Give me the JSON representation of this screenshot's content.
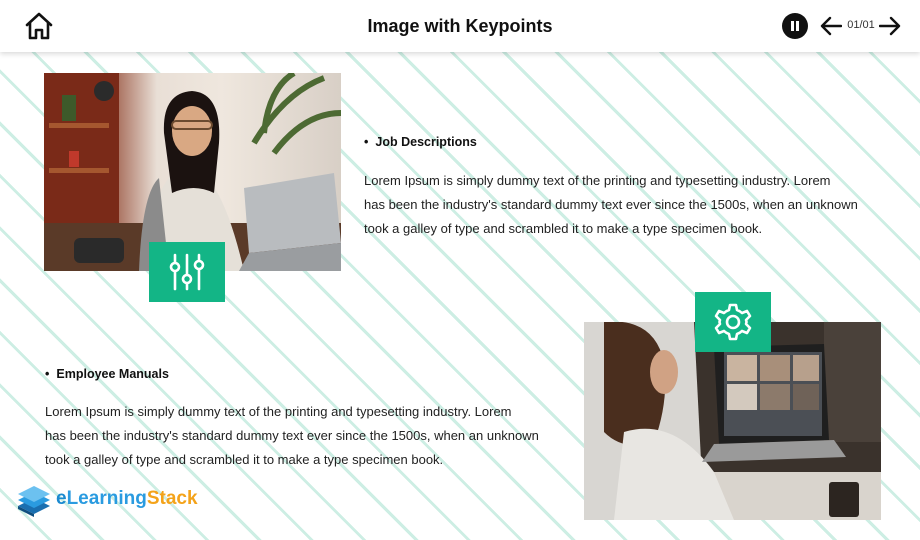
{
  "header": {
    "title": "Image with Keypoints",
    "page_counter": "01/01"
  },
  "icons": {
    "home": "home-icon",
    "pause": "pause-icon",
    "prev": "arrow-left-icon",
    "next": "arrow-right-icon",
    "badge1": "sliders-icon",
    "badge2": "gear-icon"
  },
  "colors": {
    "accent": "#13b586",
    "stripe": "#a4e0cd",
    "logo_blue": "#2a9be0",
    "logo_orange": "#f4a31a"
  },
  "keypoints": [
    {
      "title": "Job Descriptions",
      "lines": [
        "Lorem Ipsum is simply dummy text of the printing and typesetting industry. Lorem",
        "has been the industry's standard dummy text ever since the 1500s, when an unknown",
        "took a galley of type and scrambled it to make a type specimen book."
      ]
    },
    {
      "title": "Employee Manuals",
      "lines": [
        "Lorem Ipsum is simply dummy text of the printing and typesetting industry. Lorem",
        "has been the industry's standard dummy text ever since the 1500s, when an unknown",
        "took a galley of type and scrambled it to make a type specimen book."
      ]
    }
  ],
  "logo": {
    "part1": "e",
    "part2": "Learning",
    "part3": "Stack"
  }
}
